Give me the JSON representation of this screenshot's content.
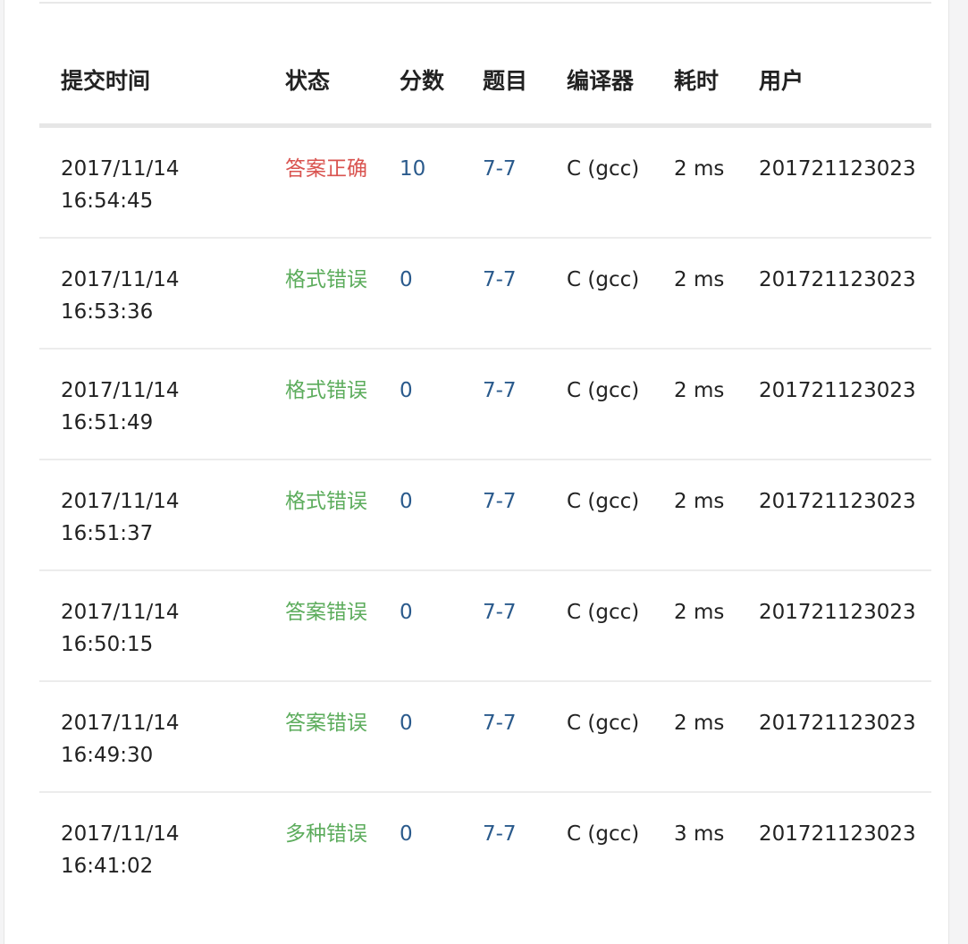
{
  "table": {
    "headers": {
      "time": "提交时间",
      "status": "状态",
      "score": "分数",
      "problem": "题目",
      "compiler": "编译器",
      "cost": "耗时",
      "user": "用户"
    },
    "rows": [
      {
        "date": "2017/11/14",
        "clock": "16:54:45",
        "status": "答案正确",
        "status_type": "accepted",
        "score": "10",
        "problem": "7-7",
        "compiler": "C (gcc)",
        "cost": "2 ms",
        "user": "201721123023"
      },
      {
        "date": "2017/11/14",
        "clock": "16:53:36",
        "status": "格式错误",
        "status_type": "error",
        "score": "0",
        "problem": "7-7",
        "compiler": "C (gcc)",
        "cost": "2 ms",
        "user": "201721123023"
      },
      {
        "date": "2017/11/14",
        "clock": "16:51:49",
        "status": "格式错误",
        "status_type": "error",
        "score": "0",
        "problem": "7-7",
        "compiler": "C (gcc)",
        "cost": "2 ms",
        "user": "201721123023"
      },
      {
        "date": "2017/11/14",
        "clock": "16:51:37",
        "status": "格式错误",
        "status_type": "error",
        "score": "0",
        "problem": "7-7",
        "compiler": "C (gcc)",
        "cost": "2 ms",
        "user": "201721123023"
      },
      {
        "date": "2017/11/14",
        "clock": "16:50:15",
        "status": "答案错误",
        "status_type": "error",
        "score": "0",
        "problem": "7-7",
        "compiler": "C (gcc)",
        "cost": "2 ms",
        "user": "201721123023"
      },
      {
        "date": "2017/11/14",
        "clock": "16:49:30",
        "status": "答案错误",
        "status_type": "error",
        "score": "0",
        "problem": "7-7",
        "compiler": "C (gcc)",
        "cost": "2 ms",
        "user": "201721123023"
      },
      {
        "date": "2017/11/14",
        "clock": "16:41:02",
        "status": "多种错误",
        "status_type": "error",
        "score": "0",
        "problem": "7-7",
        "compiler": "C (gcc)",
        "cost": "3 ms",
        "user": "201721123023"
      }
    ]
  },
  "colors": {
    "accepted": "#d9534f",
    "error": "#5cac5c",
    "link": "#2a5a8c",
    "text": "#222222"
  }
}
